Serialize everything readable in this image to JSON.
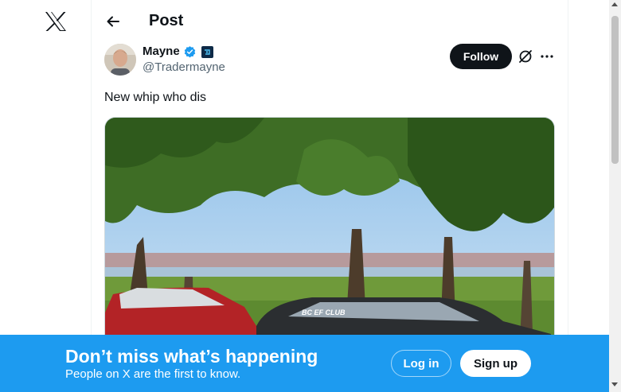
{
  "header": {
    "title": "Post"
  },
  "icons": {
    "logo": "x-logo-icon",
    "back": "arrow-left-icon",
    "verified": "verified-badge-icon",
    "affiliate": "affiliate-badge-icon",
    "grok": "grok-icon",
    "more": "more-icon"
  },
  "post": {
    "author_name": "Mayne",
    "author_handle": "@Tradermayne",
    "follow_label": "Follow",
    "text": "New whip who dis",
    "image_banner_text": "BC EF CLUB"
  },
  "banner": {
    "title": "Don’t miss what’s happening",
    "subtitle": "People on X are the first to know.",
    "login_label": "Log in",
    "signup_label": "Sign up"
  },
  "colors": {
    "accent": "#1d9bf0",
    "text": "#0f1419",
    "secondary": "#536471",
    "button_dark": "#0f1419"
  }
}
